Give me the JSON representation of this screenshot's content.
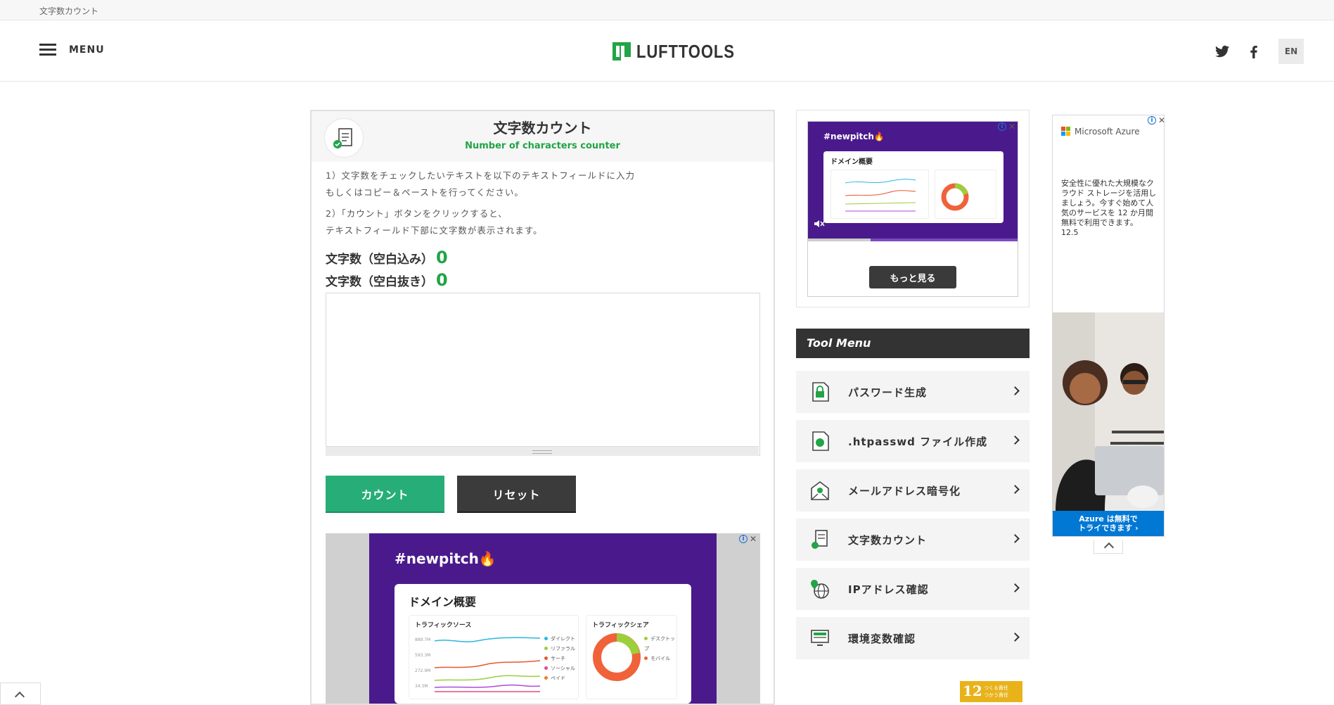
{
  "breadcrumb": "文字数カウント",
  "header": {
    "menu_label": "MENU",
    "logo_text": "LUFTTOOLS",
    "lang_label": "EN",
    "accent_color": "#22a447"
  },
  "tool": {
    "title": "文字数カウント",
    "subtitle": "Number of characters counter",
    "instruction_1_line1": "1）文字数をチェックしたいテキストを以下のテキストフィールドに入力",
    "instruction_1_line2": "もしくはコピー＆ペーストを行ってください。",
    "instruction_2_line1": "2）「カウント」ボタンをクリックすると、",
    "instruction_2_line2": "テキストフィールド下部に文字数が表示されます。",
    "count_with_spaces_label": "文字数（空白込み）",
    "count_with_spaces_value": "0",
    "count_without_spaces_label": "文字数（空白抜き）",
    "count_without_spaces_value": "0",
    "textarea_value": "",
    "count_button": "カウント",
    "reset_button": "リセット"
  },
  "ad_pitch": {
    "hashtag": "#newpitch🔥",
    "panel_title": "ドメイン概要",
    "traffic_source_label": "トラフィックソース",
    "traffic_share_label": "トラフィックシェア",
    "y_ticks": [
      "889.7M",
      "593.3M",
      "272.9M",
      "34.3M"
    ],
    "source_legend": [
      "ダイレクト",
      "リファラル",
      "サーチ",
      "ソーシャル",
      "ペイド"
    ],
    "share_legend": [
      "デスクトップ",
      "モバイル"
    ],
    "more_button": "もっと見る",
    "adchoice_i": "i",
    "adchoice_x": "✕"
  },
  "tool_menu": {
    "heading": "Tool Menu",
    "items": [
      {
        "label": "パスワード生成",
        "icon": "lock-document-icon"
      },
      {
        "label": ".htpasswd ファイル作成",
        "icon": "file-icon"
      },
      {
        "label": "メールアドレス暗号化",
        "icon": "mail-lock-icon"
      },
      {
        "label": "文字数カウント",
        "icon": "document-count-icon"
      },
      {
        "label": "IPアドレス確認",
        "icon": "globe-pin-icon"
      },
      {
        "label": "環境変数確認",
        "icon": "monitor-icon"
      }
    ]
  },
  "azure_ad": {
    "brand": "Microsoft Azure",
    "text": "安全性に優れた大規模なクラウド ストレージを活用しましょう。今すぐ始めて人気のサービスを 12 か月間 無料で利用できます。 12.5",
    "cta_line1": "Azure は無料で",
    "cta_line2": "トライできます ›"
  },
  "badge": {
    "number": "12",
    "line1": "つくる責任",
    "line2": "つかう責任"
  }
}
